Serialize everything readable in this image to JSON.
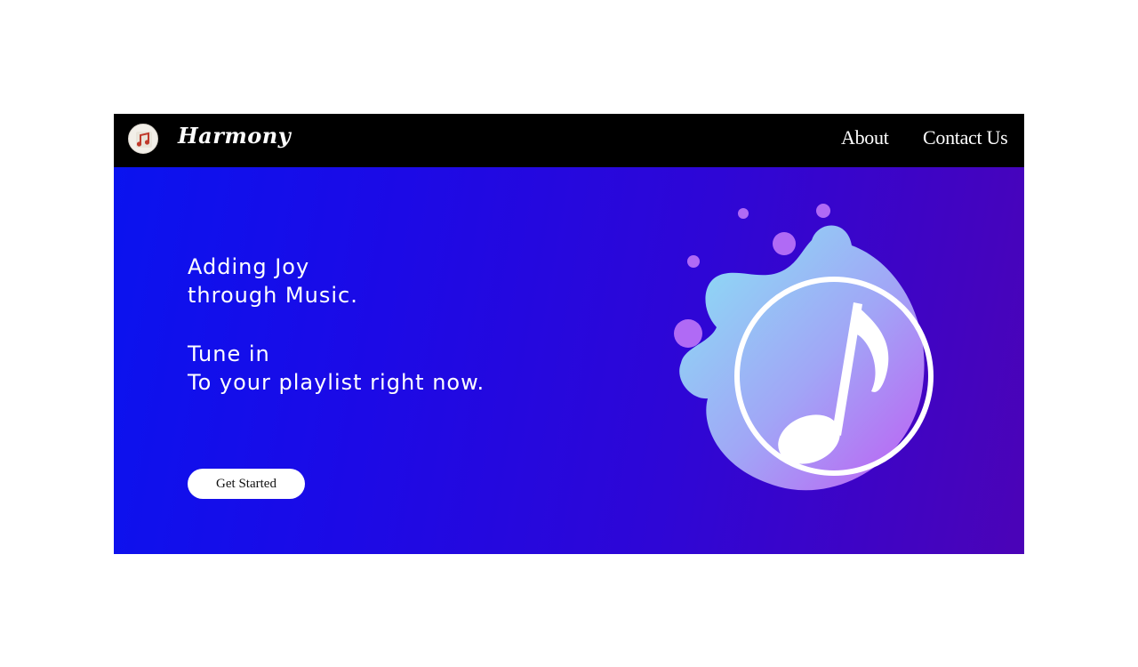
{
  "navbar": {
    "brand": "Harmony",
    "logo_icon": "music-note-icon",
    "links": [
      {
        "label": "About"
      },
      {
        "label": "Contact Us"
      }
    ]
  },
  "hero": {
    "headline_lines": [
      "Adding Joy",
      "through Music.",
      "Tune in",
      "To your playlist right now."
    ],
    "cta_label": "Get Started",
    "illustration_icon": "music-note-icon"
  },
  "colors": {
    "navbar_bg": "#000000",
    "hero_gradient_start": "#0a13ef",
    "hero_gradient_end": "#4b03b7",
    "blob_light": "#88e6f4",
    "blob_purple": "#b06af5",
    "text": "#ffffff"
  }
}
